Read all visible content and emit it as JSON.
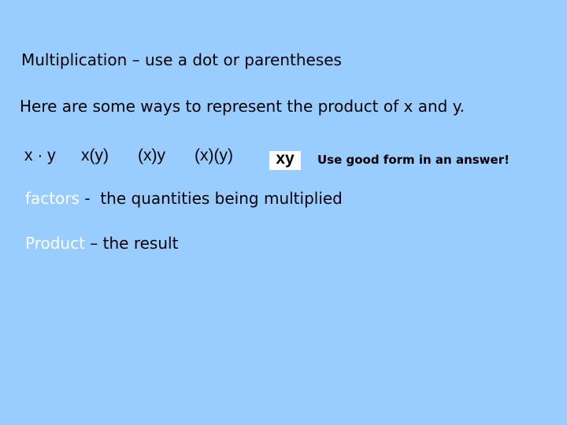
{
  "slide": {
    "title": "Multiplication – use a dot or parentheses",
    "intro": "Here are some ways to represent the product of x and y.",
    "notations": [
      "x · y",
      "x(y)",
      "(x)y",
      "(x)(y)"
    ],
    "preferred_form": "xy",
    "tip": "Use good form in an answer!",
    "definitions": [
      {
        "term": "factors",
        "separator": " -  ",
        "text": "the quantities being multiplied"
      },
      {
        "term": "Product",
        "separator": " – ",
        "text": "the result"
      }
    ]
  },
  "colors": {
    "background": "#99ccff",
    "term": "#ffffff",
    "text": "#000000",
    "preferred_box": "#ffffff"
  }
}
